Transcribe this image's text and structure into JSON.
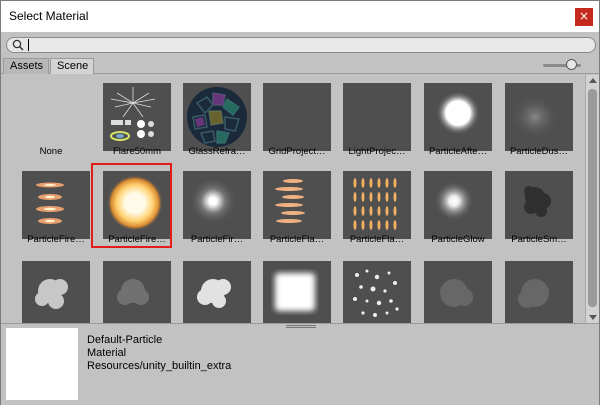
{
  "window": {
    "title": "Select Material",
    "close_label": "×"
  },
  "search": {
    "value": "",
    "placeholder": ""
  },
  "tabs": [
    {
      "label": "Assets"
    },
    {
      "label": "Scene"
    }
  ],
  "grid": {
    "items": [
      {
        "label": "None",
        "icon": "none"
      },
      {
        "label": "Flare50mm",
        "icon": "flare-icon"
      },
      {
        "label": "GlassRefra…",
        "icon": "glass-sphere-icon"
      },
      {
        "label": "GridProject…",
        "icon": "grid-projector-icon"
      },
      {
        "label": "LightProjec…",
        "icon": "light-projector-icon"
      },
      {
        "label": "ParticleAfte…",
        "icon": "particle-afterburner-icon"
      },
      {
        "label": "ParticleDus…",
        "icon": "particle-dust-icon"
      },
      {
        "label": "ParticleFire…",
        "icon": "particle-fire-streaks-icon"
      },
      {
        "label": "ParticleFire…",
        "icon": "particle-fire-blob-icon",
        "selected": true
      },
      {
        "label": "ParticleFir…",
        "icon": "particle-fire-dot-icon"
      },
      {
        "label": "ParticleFla…",
        "icon": "particle-flame-streaks-icon"
      },
      {
        "label": "ParticleFla…",
        "icon": "particle-flame-grid-icon"
      },
      {
        "label": "ParticleGlow",
        "icon": "particle-glow-icon"
      },
      {
        "label": "ParticleSm…",
        "icon": "particle-smoke-icon"
      },
      {
        "label": "",
        "icon": "smoke-cloud-icon"
      },
      {
        "label": "",
        "icon": "faint-smoke-icon"
      },
      {
        "label": "",
        "icon": "white-cloud-icon"
      },
      {
        "label": "",
        "icon": "white-square-glow-icon"
      },
      {
        "label": "",
        "icon": "scattered-particles-icon"
      },
      {
        "label": "",
        "icon": "faint-cloud-icon"
      },
      {
        "label": "",
        "icon": "faint-cloud-icon"
      }
    ]
  },
  "preview": {
    "name": "Default-Particle",
    "type": "Material",
    "path": "Resources/unity_builtin_extra"
  },
  "colors": {
    "selection_border": "#e21b1b",
    "tile_bg": "#4f4f4f",
    "window_bg": "#c2c2c2"
  }
}
